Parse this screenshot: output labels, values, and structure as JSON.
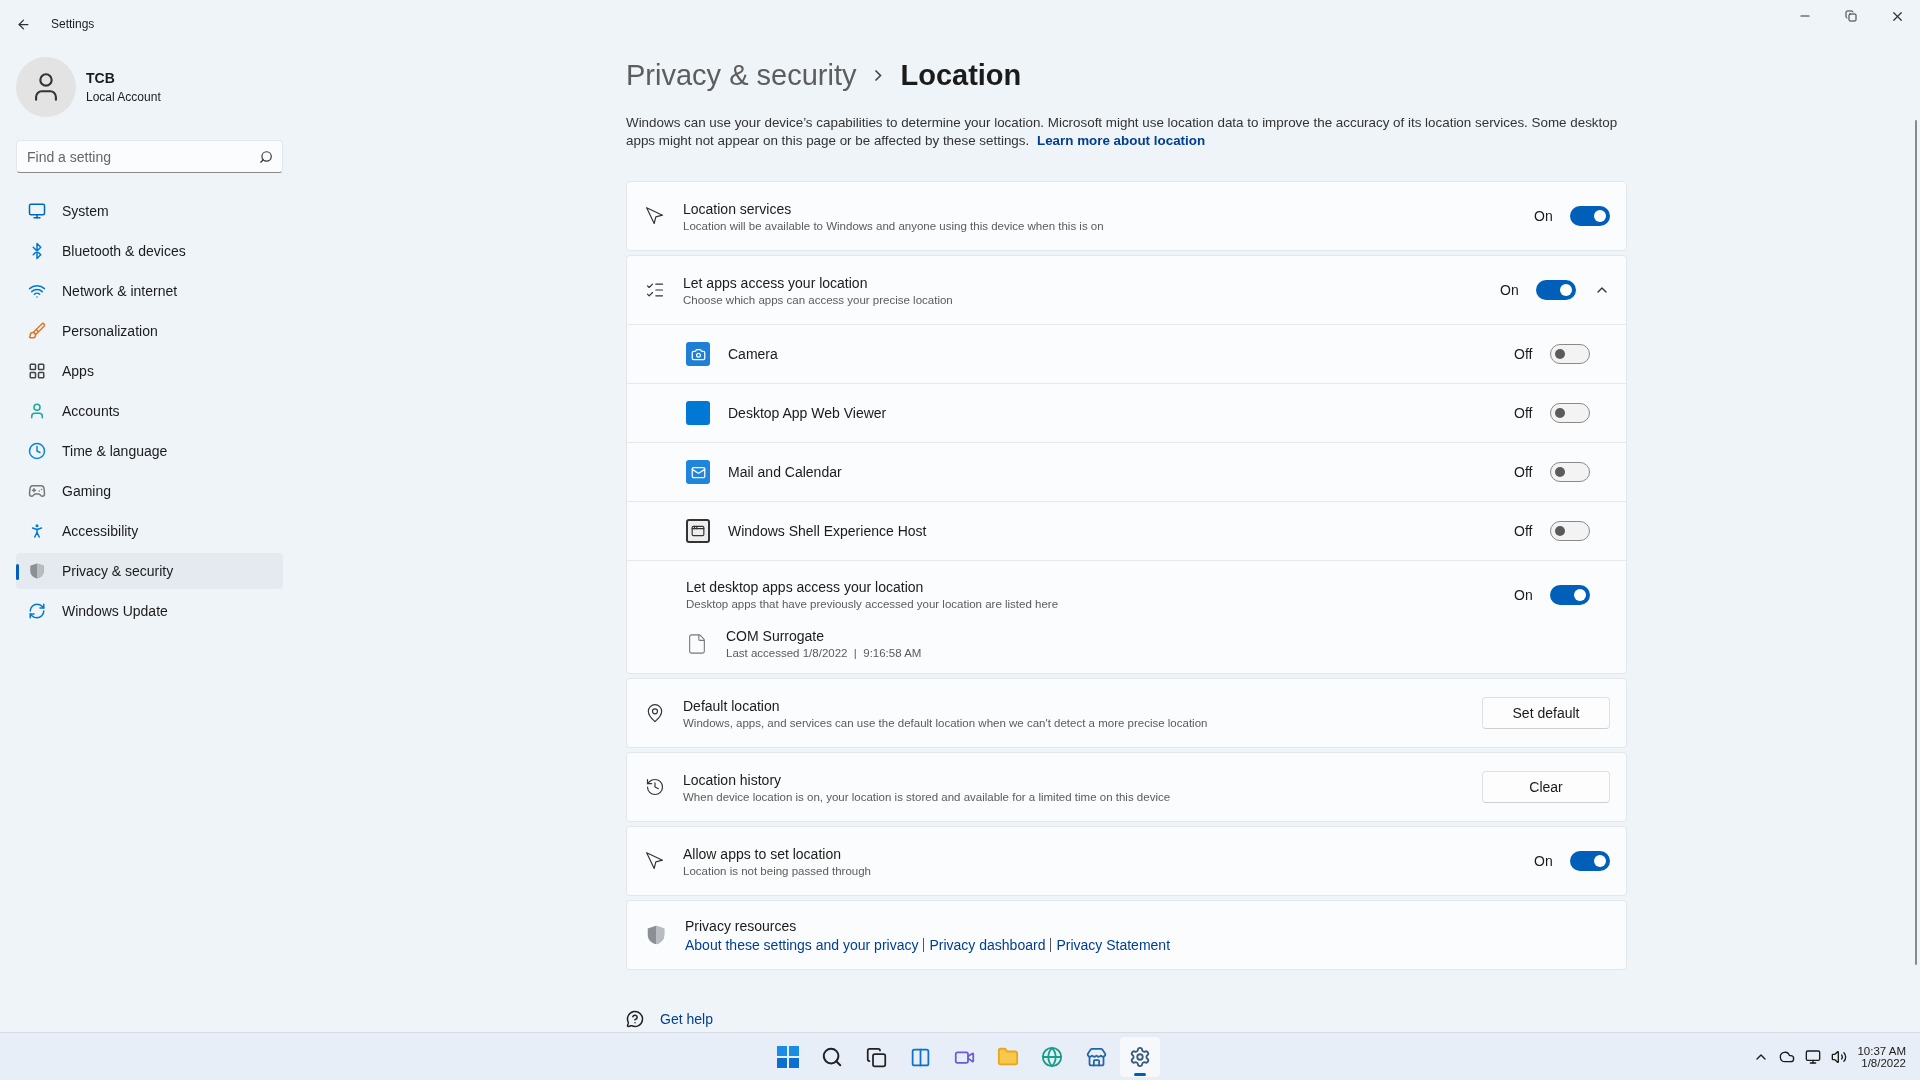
{
  "window": {
    "title": "Settings"
  },
  "account": {
    "name": "TCB",
    "type": "Local Account"
  },
  "search": {
    "placeholder": "Find a setting"
  },
  "nav": [
    {
      "label": "System",
      "selected": false
    },
    {
      "label": "Bluetooth & devices",
      "selected": false
    },
    {
      "label": "Network & internet",
      "selected": false
    },
    {
      "label": "Personalization",
      "selected": false
    },
    {
      "label": "Apps",
      "selected": false
    },
    {
      "label": "Accounts",
      "selected": false
    },
    {
      "label": "Time & language",
      "selected": false
    },
    {
      "label": "Gaming",
      "selected": false
    },
    {
      "label": "Accessibility",
      "selected": false
    },
    {
      "label": "Privacy & security",
      "selected": true
    },
    {
      "label": "Windows Update",
      "selected": false
    }
  ],
  "breadcrumb": {
    "parent": "Privacy & security",
    "current": "Location"
  },
  "description": {
    "text": "Windows can use your device’s capabilities to determine your location. Microsoft might use location data to improve the accuracy of its location services. Some desktop apps might not appear on this page or be affected by these settings.",
    "link": "Learn more about location"
  },
  "cards": [
    {
      "kind": "toggle",
      "title": "Location services",
      "subtitle": "Location will be available to Windows and anyone using this device when this is on",
      "state_label": "On",
      "on": true
    },
    {
      "kind": "group",
      "title": "Let apps access your location",
      "subtitle": "Choose which apps can access your precise location",
      "state_label": "On",
      "on": true,
      "expanded": true,
      "apps": [
        {
          "name": "Camera",
          "state_label": "Off",
          "on": false
        },
        {
          "name": "Desktop App Web Viewer",
          "state_label": "Off",
          "on": false
        },
        {
          "name": "Mail and Calendar",
          "state_label": "Off",
          "on": false
        },
        {
          "name": "Windows Shell Experience Host",
          "state_label": "Off",
          "on": false
        }
      ],
      "desktop": {
        "title": "Let desktop apps access your location",
        "subtitle": "Desktop apps that have previously accessed your location are listed here",
        "state_label": "On",
        "on": true,
        "apps": [
          {
            "name": "COM Surrogate",
            "detail": "Last accessed 1/8/2022  |  9:16:58 AM"
          }
        ]
      }
    },
    {
      "kind": "button",
      "title": "Default location",
      "subtitle": "Windows, apps, and services can use the default location when we can't detect a more precise location",
      "button": "Set default"
    },
    {
      "kind": "button",
      "title": "Location history",
      "subtitle": "When device location is on, your location is stored and available for a limited time on this device",
      "button": "Clear"
    },
    {
      "kind": "toggle",
      "title": "Allow apps to set location",
      "subtitle": "Location is not being passed through",
      "state_label": "On",
      "on": true
    },
    {
      "kind": "links",
      "title": "Privacy resources",
      "links": [
        "About these settings and your privacy",
        "Privacy dashboard",
        "Privacy Statement"
      ]
    }
  ],
  "help": {
    "label": "Get help"
  },
  "taskbar": {
    "apps": [
      {
        "selected": false
      },
      {
        "selected": false
      },
      {
        "selected": false
      },
      {
        "selected": false
      },
      {
        "selected": false
      },
      {
        "selected": false
      },
      {
        "selected": false
      },
      {
        "selected": false
      },
      {
        "selected": true
      }
    ],
    "time": "10:37 AM",
    "date": "1/8/2022"
  }
}
